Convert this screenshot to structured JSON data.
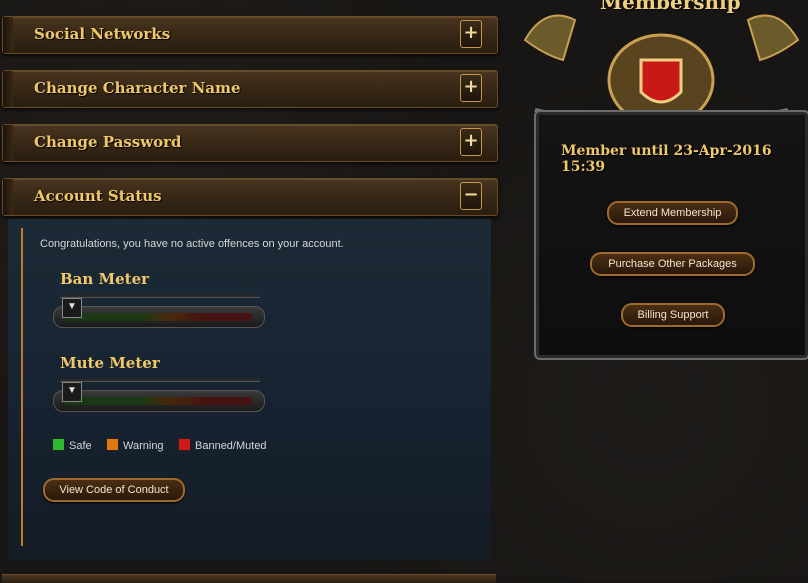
{
  "sections": [
    {
      "title": "Social Networks",
      "toggle": "+"
    },
    {
      "title": "Change Character Name",
      "toggle": "+"
    },
    {
      "title": "Change Password",
      "toggle": "+"
    },
    {
      "title": "Account Status",
      "toggle": "−"
    }
  ],
  "account_status": {
    "message": "Congratulations, you have no active offences on your account.",
    "ban_meter": {
      "title": "Ban Meter",
      "level": 0
    },
    "mute_meter": {
      "title": "Mute Meter",
      "level": 0
    },
    "legend": [
      {
        "label": "Safe",
        "color": "#2eb82e"
      },
      {
        "label": "Warning",
        "color": "#e07a10"
      },
      {
        "label": "Banned/Muted",
        "color": "#d21818"
      }
    ],
    "conduct_button": "View Code of Conduct"
  },
  "membership": {
    "title": "Membership",
    "until": "Member until 23-Apr-2016 15:39",
    "buttons": [
      "Extend Membership",
      "Purchase Other Packages",
      "Billing Support"
    ]
  },
  "colors": {
    "accent": "#f0c86a",
    "panel": "#162230"
  }
}
